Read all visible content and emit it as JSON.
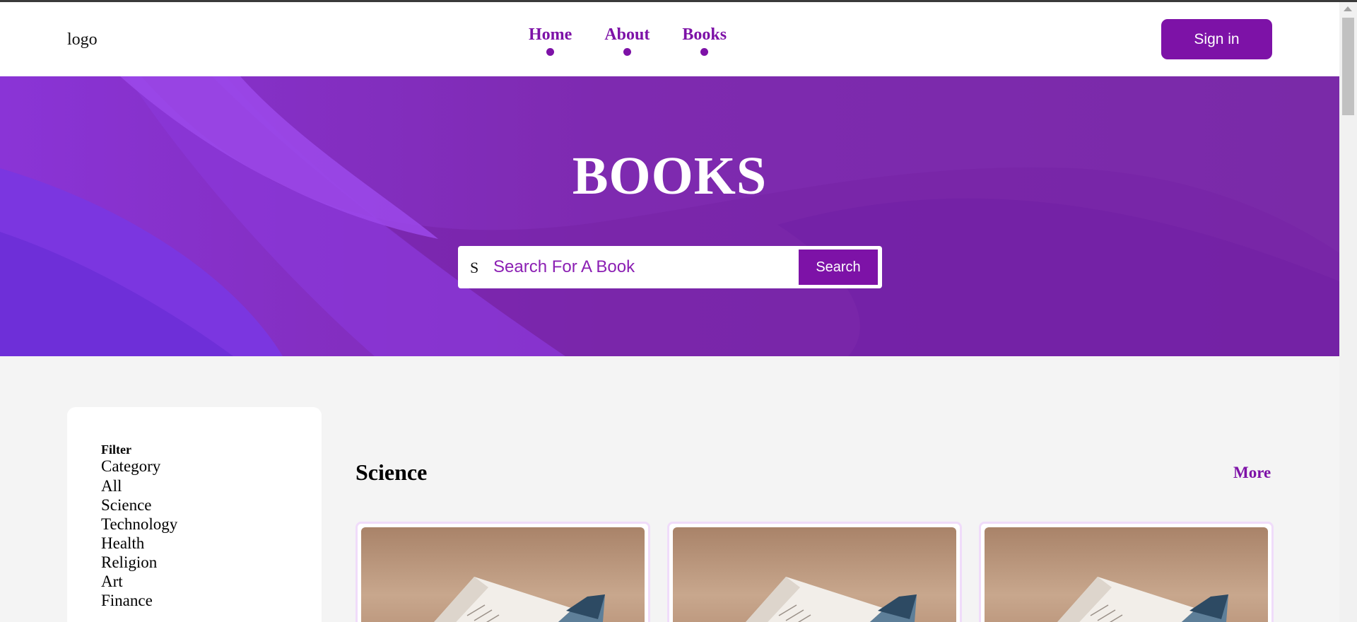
{
  "header": {
    "logo": "logo",
    "nav": [
      {
        "label": "Home"
      },
      {
        "label": "About"
      },
      {
        "label": "Books"
      }
    ],
    "signin_label": "Sign in"
  },
  "hero": {
    "title": "BOOKS",
    "search": {
      "icon_glyph": "S",
      "placeholder": "Search For A Book",
      "button_label": "Search"
    }
  },
  "filter": {
    "title": "Filter",
    "category_label": "Category",
    "items": [
      "All",
      "Science",
      "Technology",
      "Health",
      "Religion",
      "Art",
      "Finance"
    ]
  },
  "section": {
    "title": "Science",
    "more_label": "More"
  },
  "cards": [
    {
      "image": "open-book-photo"
    },
    {
      "image": "open-book-photo"
    },
    {
      "image": "open-book-photo"
    }
  ],
  "colors": {
    "accent": "#7d12a7",
    "hero_bg": "#7a2aa8",
    "page_bg": "#f4f4f4"
  }
}
